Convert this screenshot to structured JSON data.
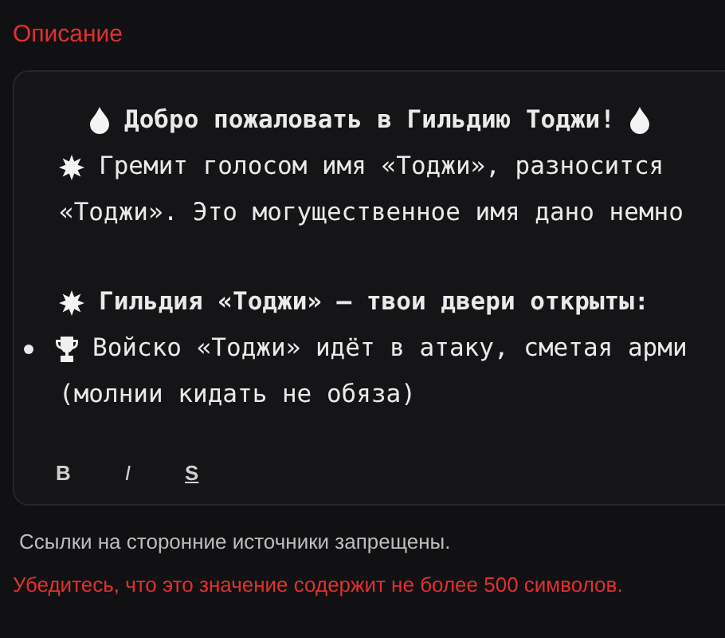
{
  "field": {
    "label": "Описание",
    "lines": [
      {
        "kind": "title",
        "text": "Добро пожаловать в Гильдию Тоджи!"
      },
      {
        "kind": "burst",
        "text": "Гремит голосом имя «Тоджи», разносится"
      },
      {
        "kind": "plain",
        "text": "«Тоджи». Это могущественное имя дано немно"
      },
      {
        "kind": "burst-heading",
        "text": "Гильдия «Тоджи» — твои двери открыты:"
      },
      {
        "kind": "trophy-bullet",
        "text": "Войско «Тоджи» идёт в атаку, сметая арми"
      },
      {
        "kind": "continuation",
        "text": "(молнии кидать не обяза)"
      }
    ],
    "toolbar": [
      {
        "kind": "bold",
        "text": "B"
      },
      {
        "kind": "italic",
        "text": "I"
      },
      {
        "kind": "strike",
        "text": "S"
      }
    ],
    "help": "Ссылки на сторонние источники запрещены.",
    "error": "Убедитесь, что это значение содержит не более 500 символов."
  }
}
